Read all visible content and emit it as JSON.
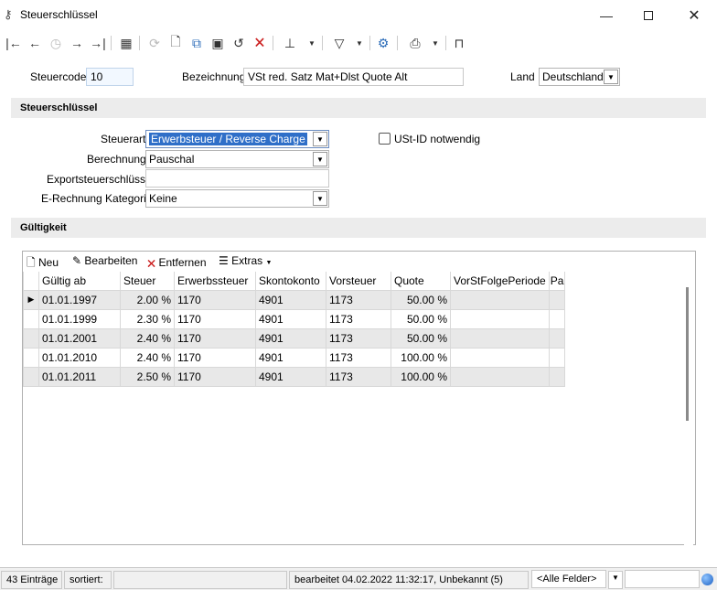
{
  "window": {
    "title": "Steuerschlüssel",
    "icons": {
      "app": "key-icon",
      "minimize": "minimize-icon",
      "maximize": "maximize-icon",
      "close": "close-icon"
    }
  },
  "header": {
    "steuercode_label": "Steuercode",
    "steuercode_value": "10",
    "bezeichnung_label": "Bezeichnung",
    "bezeichnung_value": "VSt red. Satz Mat+Dlst Quote Alt",
    "land_label": "Land",
    "land_value": "Deutschland"
  },
  "section_steuerschluessel": {
    "title": "Steuerschlüssel",
    "steuerart_label": "Steuerart",
    "steuerart_value": "Erwerbsteuer / Reverse Charge",
    "berechnung_label": "Berechnung",
    "berechnung_value": "Pauschal",
    "exportsteuerschluessel_label": "Exportsteuerschlüssel",
    "exportsteuerschluessel_value": "",
    "erechnung_label": "E-Rechnung Kategorie",
    "erechnung_value": "Keine",
    "ustid_label": "USt-ID notwendig",
    "ustid_checked": false
  },
  "section_gueltigkeit": {
    "title": "Gültigkeit",
    "tools": {
      "neu": "Neu",
      "bearbeiten": "Bearbeiten",
      "entfernen": "Entfernen",
      "extras": "Extras"
    },
    "columns": [
      "Gültig ab",
      "Steuer",
      "Erwerbssteuer",
      "Skontokonto",
      "Vorsteuer",
      "Quote",
      "VorStFolgePeriode",
      "Pa"
    ],
    "rows": [
      {
        "gueltig_ab": "01.01.1997",
        "steuer": "2.00 %",
        "erwerbssteuer": "1170",
        "skontokonto": "4901",
        "vorsteuer": "1173",
        "quote": "50.00 %",
        "folge": "",
        "pa": ""
      },
      {
        "gueltig_ab": "01.01.1999",
        "steuer": "2.30 %",
        "erwerbssteuer": "1170",
        "skontokonto": "4901",
        "vorsteuer": "1173",
        "quote": "50.00 %",
        "folge": "",
        "pa": ""
      },
      {
        "gueltig_ab": "01.01.2001",
        "steuer": "2.40 %",
        "erwerbssteuer": "1170",
        "skontokonto": "4901",
        "vorsteuer": "1173",
        "quote": "50.00 %",
        "folge": "",
        "pa": ""
      },
      {
        "gueltig_ab": "01.01.2010",
        "steuer": "2.40 %",
        "erwerbssteuer": "1170",
        "skontokonto": "4901",
        "vorsteuer": "1173",
        "quote": "100.00 %",
        "folge": "",
        "pa": ""
      },
      {
        "gueltig_ab": "01.01.2011",
        "steuer": "2.50 %",
        "erwerbssteuer": "1170",
        "skontokonto": "4901",
        "vorsteuer": "1173",
        "quote": "100.00 %",
        "folge": "",
        "pa": ""
      }
    ]
  },
  "statusbar": {
    "count": "43 Einträge",
    "sorted": "sortiert:",
    "sorted_value": "",
    "edited": "bearbeitet 04.02.2022 11:32:17, Unbekannt (5)",
    "filter_value": "<Alle Felder>",
    "search_value": ""
  }
}
